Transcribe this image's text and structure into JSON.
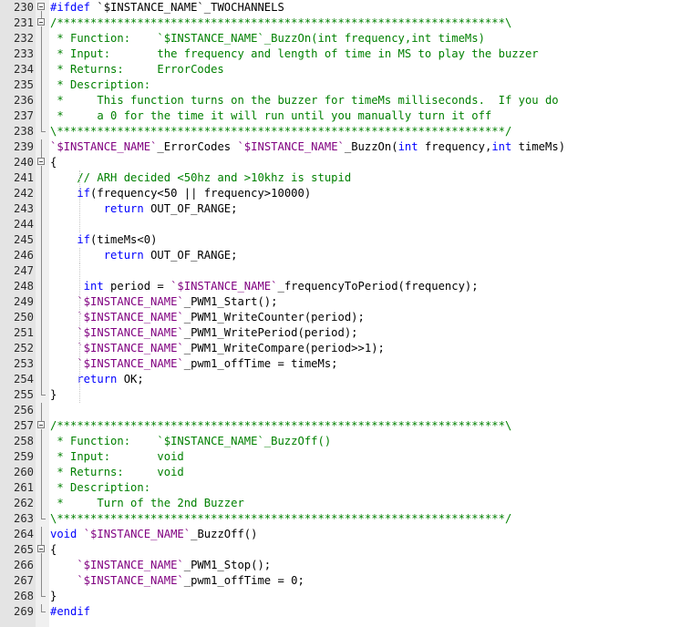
{
  "editor": {
    "lines": [
      {
        "number": "230",
        "fold": "box",
        "tokens": [
          {
            "cls": "k",
            "text": "#ifdef"
          },
          {
            "cls": "t",
            "text": " `$INSTANCE_NAME`_TWOCHANNELS"
          }
        ]
      },
      {
        "number": "231",
        "fold": "box",
        "tokens": [
          {
            "cls": "c",
            "text": "/*******************************************************************\\"
          }
        ]
      },
      {
        "number": "232",
        "fold": "line",
        "tokens": [
          {
            "cls": "c",
            "text": " * Function:    `$INSTANCE_NAME`_BuzzOn(int frequency,int timeMs)"
          }
        ]
      },
      {
        "number": "233",
        "fold": "line",
        "tokens": [
          {
            "cls": "c",
            "text": " * Input:       the frequency and length of time in MS to play the buzzer"
          }
        ]
      },
      {
        "number": "234",
        "fold": "line",
        "tokens": [
          {
            "cls": "c",
            "text": " * Returns:     ErrorCodes"
          }
        ]
      },
      {
        "number": "235",
        "fold": "line",
        "tokens": [
          {
            "cls": "c",
            "text": " * Description:"
          }
        ]
      },
      {
        "number": "236",
        "fold": "line",
        "tokens": [
          {
            "cls": "c",
            "text": " *     This function turns on the buzzer for timeMs milliseconds.  If you do"
          }
        ]
      },
      {
        "number": "237",
        "fold": "line",
        "tokens": [
          {
            "cls": "c",
            "text": " *     a 0 for the time it will run until you manually turn it off"
          }
        ]
      },
      {
        "number": "238",
        "fold": "end",
        "tokens": [
          {
            "cls": "c",
            "text": "\\*******************************************************************/"
          }
        ]
      },
      {
        "number": "239",
        "fold": "line",
        "tokens": [
          {
            "cls": "m",
            "text": "`$INSTANCE_NAME`"
          },
          {
            "cls": "t",
            "text": "_ErrorCodes "
          },
          {
            "cls": "m",
            "text": "`$INSTANCE_NAME`"
          },
          {
            "cls": "t",
            "text": "_BuzzOn("
          },
          {
            "cls": "k",
            "text": "int"
          },
          {
            "cls": "t",
            "text": " frequency,"
          },
          {
            "cls": "k",
            "text": "int"
          },
          {
            "cls": "t",
            "text": " timeMs)"
          }
        ]
      },
      {
        "number": "240",
        "fold": "box",
        "tokens": [
          {
            "cls": "t",
            "text": "{"
          }
        ]
      },
      {
        "number": "241",
        "fold": "line",
        "tokens": [
          {
            "cls": "c",
            "text": "    // ARH decided <50hz and >10khz is stupid"
          }
        ]
      },
      {
        "number": "242",
        "fold": "line",
        "tokens": [
          {
            "cls": "k",
            "text": "    if"
          },
          {
            "cls": "t",
            "text": "(frequency<50 || frequency>10000)"
          }
        ]
      },
      {
        "number": "243",
        "fold": "line",
        "tokens": [
          {
            "cls": "k",
            "text": "        return"
          },
          {
            "cls": "t",
            "text": " OUT_OF_RANGE;"
          }
        ]
      },
      {
        "number": "244",
        "fold": "line",
        "tokens": [
          {
            "cls": "t",
            "text": ""
          }
        ]
      },
      {
        "number": "245",
        "fold": "line",
        "tokens": [
          {
            "cls": "k",
            "text": "    if"
          },
          {
            "cls": "t",
            "text": "(timeMs<0)"
          }
        ]
      },
      {
        "number": "246",
        "fold": "line",
        "tokens": [
          {
            "cls": "k",
            "text": "        return"
          },
          {
            "cls": "t",
            "text": " OUT_OF_RANGE;"
          }
        ]
      },
      {
        "number": "247",
        "fold": "line",
        "tokens": [
          {
            "cls": "t",
            "text": ""
          }
        ]
      },
      {
        "number": "248",
        "fold": "line",
        "tokens": [
          {
            "cls": "k",
            "text": "     int"
          },
          {
            "cls": "t",
            "text": " period = "
          },
          {
            "cls": "m",
            "text": "`$INSTANCE_NAME`"
          },
          {
            "cls": "t",
            "text": "_frequencyToPeriod(frequency);"
          }
        ]
      },
      {
        "number": "249",
        "fold": "line",
        "tokens": [
          {
            "cls": "m",
            "text": "    `$INSTANCE_NAME`"
          },
          {
            "cls": "t",
            "text": "_PWM1_Start();"
          }
        ]
      },
      {
        "number": "250",
        "fold": "line",
        "tokens": [
          {
            "cls": "m",
            "text": "    `$INSTANCE_NAME`"
          },
          {
            "cls": "t",
            "text": "_PWM1_WriteCounter(period);"
          }
        ]
      },
      {
        "number": "251",
        "fold": "line",
        "tokens": [
          {
            "cls": "m",
            "text": "    `$INSTANCE_NAME`"
          },
          {
            "cls": "t",
            "text": "_PWM1_WritePeriod(period);"
          }
        ]
      },
      {
        "number": "252",
        "fold": "line",
        "tokens": [
          {
            "cls": "m",
            "text": "    `$INSTANCE_NAME`"
          },
          {
            "cls": "t",
            "text": "_PWM1_WriteCompare(period>>1);"
          }
        ]
      },
      {
        "number": "253",
        "fold": "line",
        "tokens": [
          {
            "cls": "m",
            "text": "    `$INSTANCE_NAME`"
          },
          {
            "cls": "t",
            "text": "_pwm1_offTime = timeMs;"
          }
        ]
      },
      {
        "number": "254",
        "fold": "line",
        "tokens": [
          {
            "cls": "k",
            "text": "    return"
          },
          {
            "cls": "t",
            "text": " OK;"
          }
        ]
      },
      {
        "number": "255",
        "fold": "end",
        "tokens": [
          {
            "cls": "t",
            "text": "}"
          }
        ]
      },
      {
        "number": "256",
        "fold": "line",
        "tokens": [
          {
            "cls": "t",
            "text": ""
          }
        ]
      },
      {
        "number": "257",
        "fold": "box",
        "tokens": [
          {
            "cls": "c",
            "text": "/*******************************************************************\\"
          }
        ]
      },
      {
        "number": "258",
        "fold": "line",
        "tokens": [
          {
            "cls": "c",
            "text": " * Function:    `$INSTANCE_NAME`_BuzzOff()"
          }
        ]
      },
      {
        "number": "259",
        "fold": "line",
        "tokens": [
          {
            "cls": "c",
            "text": " * Input:       void"
          }
        ]
      },
      {
        "number": "260",
        "fold": "line",
        "tokens": [
          {
            "cls": "c",
            "text": " * Returns:     void"
          }
        ]
      },
      {
        "number": "261",
        "fold": "line",
        "tokens": [
          {
            "cls": "c",
            "text": " * Description:"
          }
        ]
      },
      {
        "number": "262",
        "fold": "line",
        "tokens": [
          {
            "cls": "c",
            "text": " *     Turn of the 2nd Buzzer"
          }
        ]
      },
      {
        "number": "263",
        "fold": "end",
        "tokens": [
          {
            "cls": "c",
            "text": "\\*******************************************************************/"
          }
        ]
      },
      {
        "number": "264",
        "fold": "line",
        "tokens": [
          {
            "cls": "k",
            "text": "void"
          },
          {
            "cls": "t",
            "text": " "
          },
          {
            "cls": "m",
            "text": "`$INSTANCE_NAME`"
          },
          {
            "cls": "t",
            "text": "_BuzzOff()"
          }
        ]
      },
      {
        "number": "265",
        "fold": "box",
        "tokens": [
          {
            "cls": "t",
            "text": "{"
          }
        ]
      },
      {
        "number": "266",
        "fold": "line",
        "tokens": [
          {
            "cls": "m",
            "text": "    `$INSTANCE_NAME`"
          },
          {
            "cls": "t",
            "text": "_PWM1_Stop();"
          }
        ]
      },
      {
        "number": "267",
        "fold": "line",
        "tokens": [
          {
            "cls": "m",
            "text": "    `$INSTANCE_NAME`"
          },
          {
            "cls": "t",
            "text": "_pwm1_offTime = 0;"
          }
        ]
      },
      {
        "number": "268",
        "fold": "end",
        "tokens": [
          {
            "cls": "t",
            "text": "}"
          }
        ]
      },
      {
        "number": "269",
        "fold": "end",
        "tokens": [
          {
            "cls": "k",
            "text": "#endif"
          }
        ]
      }
    ]
  },
  "colors": {
    "comment": "#008000",
    "keyword": "#0000ff",
    "macro": "#800080",
    "text": "#000000",
    "gutter": "#e4e4e4"
  }
}
